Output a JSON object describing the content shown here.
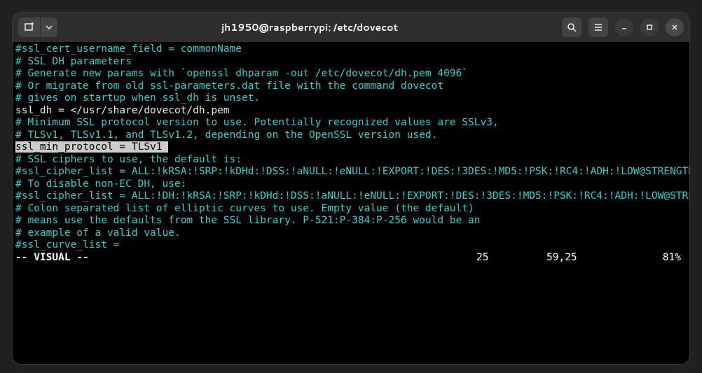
{
  "titlebar": {
    "title": "jh1950@raspberrypi: /etc/dovecot"
  },
  "content": {
    "l1": "#ssl_cert_username_field = commonName",
    "l2": "",
    "l3": "# SSL DH parameters",
    "l4": "# Generate new params with `openssl dhparam -out /etc/dovecot/dh.pem 4096`",
    "l5": "# Or migrate from old ssl-parameters.dat file with the command dovecot",
    "l6": "# gives on startup when ssl_dh is unset.",
    "l7": "ssl_dh = </usr/share/dovecot/dh.pem",
    "l8": "",
    "l9": "# Minimum SSL protocol version to use. Potentially recognized values are SSLv3,",
    "l10": "# TLSv1, TLSv1.1, and TLSv1.2, depending on the OpenSSL version used.",
    "l11": "ssl_min_protocol = TLSv1",
    "l12": "",
    "l13": "# SSL ciphers to use, the default is:",
    "l14": "#ssl_cipher_list = ALL:!kRSA:!SRP:!kDHd:!DSS:!aNULL:!eNULL:!EXPORT:!DES:!3DES:!MD5:!PSK:!RC4:!ADH:!LOW@STRENGTH",
    "l15": "# To disable non-EC DH, use:",
    "l16": "#ssl_cipher_list = ALL:!DH:!kRSA:!SRP:!kDHd:!DSS:!aNULL:!eNULL:!EXPORT:!DES:!3DES:!MD5:!PSK:!RC4:!ADH:!LOW@STRENGTH",
    "l17": "",
    "l18": "# Colon separated list of elliptic curves to use. Empty value (the default)",
    "l19": "# means use the defaults from the SSL library. P-521:P-384:P-256 would be an",
    "l20": "# example of a valid value.",
    "l21": "#ssl_curve_list ="
  },
  "status": {
    "mode": "-- VISUAL --",
    "num": "25",
    "pos": "59,25",
    "pct": "81%"
  }
}
